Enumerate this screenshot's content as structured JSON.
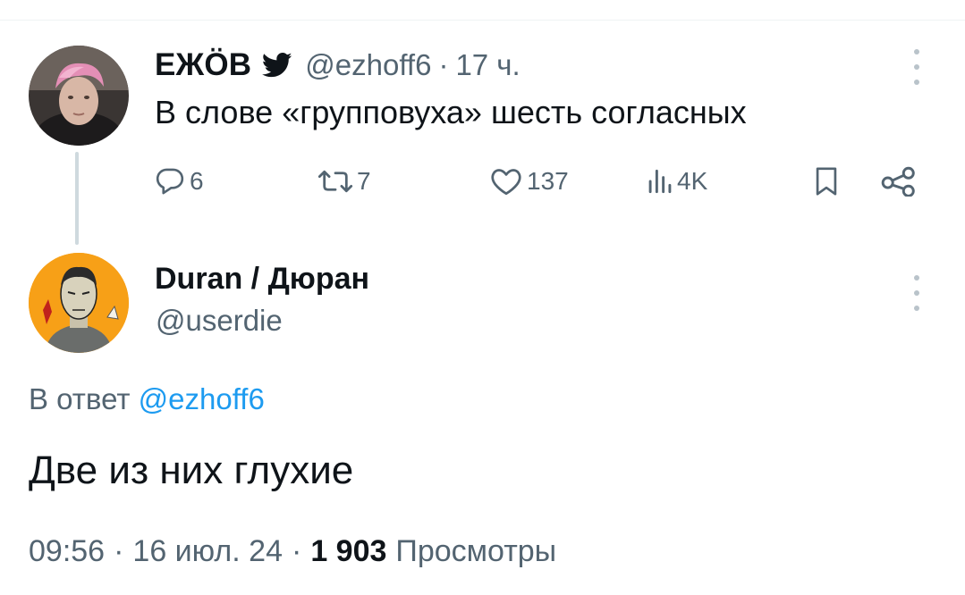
{
  "parent_tweet": {
    "author_name": "ЕЖÖВ",
    "handle": "@ezhoff6",
    "separator": "·",
    "time_ago": "17 ч.",
    "text": "В слове «групповуха» шесть согласных",
    "avatar_icon": "user-avatar",
    "badge_icon": "twitter-bird-icon",
    "actions": {
      "replies": "6",
      "retweets": "7",
      "likes": "137",
      "views": "4K"
    }
  },
  "reply_tweet": {
    "author_name": "Duran / Дюран",
    "handle": "@userdie",
    "avatar_icon": "user-avatar",
    "reply_to_label": "В ответ",
    "reply_to_handle": "@ezhoff6",
    "text": "Две из них глухие",
    "time": "09:56",
    "separator": "·",
    "date": "16 июл. 24",
    "views_count": "1 903",
    "views_label": "Просмотры"
  },
  "colors": {
    "text_primary": "#0f1419",
    "text_secondary": "#536471",
    "accent_link": "#1d9bf0",
    "thread_line": "#cfd9de",
    "avatar_2_bg": "#f7a017"
  }
}
